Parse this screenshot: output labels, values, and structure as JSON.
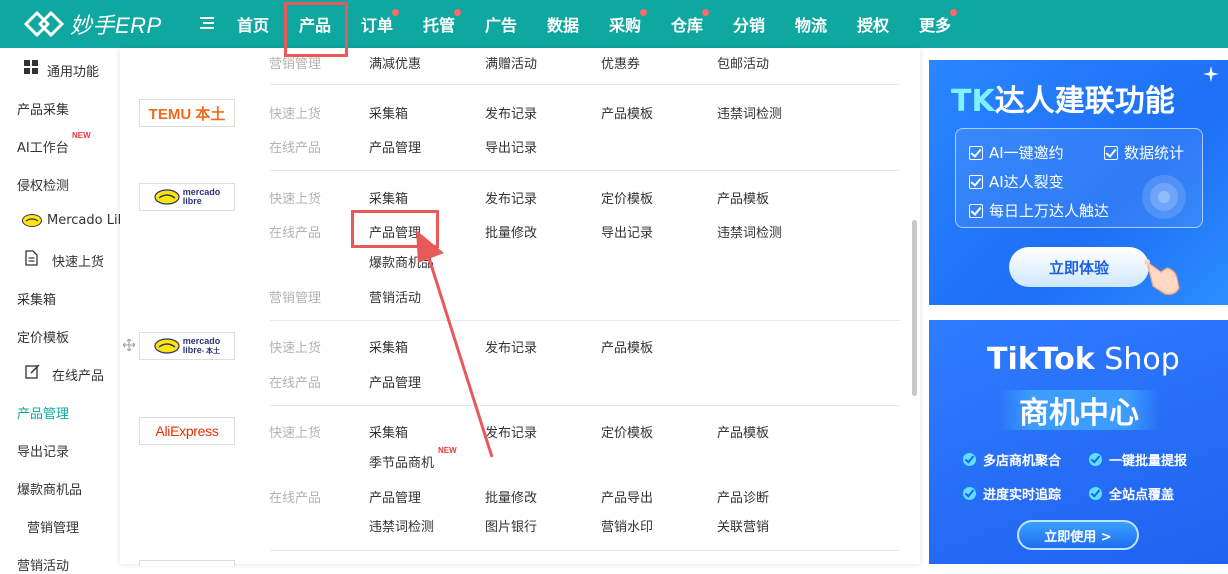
{
  "app": {
    "logo_text": "妙手ERP"
  },
  "nav": [
    {
      "label": "首页",
      "dot": false
    },
    {
      "label": "产品",
      "dot": false
    },
    {
      "label": "订单",
      "dot": true
    },
    {
      "label": "托管",
      "dot": true
    },
    {
      "label": "广告",
      "dot": false
    },
    {
      "label": "数据",
      "dot": false
    },
    {
      "label": "采购",
      "dot": true
    },
    {
      "label": "仓库",
      "dot": true
    },
    {
      "label": "分销",
      "dot": false
    },
    {
      "label": "物流",
      "dot": false
    },
    {
      "label": "授权",
      "dot": false
    },
    {
      "label": "更多",
      "dot": true
    }
  ],
  "sidebar": {
    "items": [
      {
        "label": "通用功能"
      },
      {
        "label": "产品采集"
      },
      {
        "label": "AI工作台",
        "badge": "NEW"
      },
      {
        "label": "侵权检测"
      },
      {
        "label": "Mercado Lib"
      },
      {
        "label": "快速上货"
      },
      {
        "label": "采集箱"
      },
      {
        "label": "定价模板"
      },
      {
        "label": "在线产品"
      },
      {
        "label": "产品管理"
      },
      {
        "label": "导出记录"
      },
      {
        "label": "爆款商机品"
      },
      {
        "label": "营销管理"
      },
      {
        "label": "营销活动"
      }
    ]
  },
  "panel": {
    "top_row": {
      "category": "营销管理",
      "links": [
        "满减优惠",
        "满赠活动",
        "优惠券",
        "包邮活动"
      ]
    },
    "temu": {
      "brand": "TEMU 本土",
      "rows": [
        {
          "category": "快速上货",
          "links": [
            "采集箱",
            "发布记录",
            "产品模板",
            "违禁词检测"
          ]
        },
        {
          "category": "在线产品",
          "links": [
            "产品管理",
            "导出记录"
          ]
        }
      ]
    },
    "mercado": {
      "brand_line1": "mercado",
      "brand_line2": "libre",
      "rows": [
        {
          "category": "快速上货",
          "links": [
            "采集箱",
            "发布记录",
            "定价模板",
            "产品模板"
          ]
        },
        {
          "category": "在线产品",
          "links": [
            "产品管理",
            "批量修改",
            "导出记录",
            "违禁词检测",
            "爆款商机品"
          ]
        },
        {
          "category": "营销管理",
          "links": [
            "营销活动"
          ]
        }
      ]
    },
    "mercado_local": {
      "brand_line1": "mercado",
      "brand_line2": "libre",
      "brand_suffix": "- 本土",
      "rows": [
        {
          "category": "快速上货",
          "links": [
            "采集箱",
            "发布记录",
            "产品模板"
          ]
        },
        {
          "category": "在线产品",
          "links": [
            "产品管理"
          ]
        }
      ]
    },
    "aliexpress": {
      "brand": "AliExpress",
      "rows": [
        {
          "category": "快速上货",
          "links": [
            "采集箱",
            "发布记录",
            "定价模板",
            "产品模板",
            "季节品商机"
          ],
          "badge": "NEW"
        },
        {
          "category": "在线产品",
          "links": [
            "产品管理",
            "批量修改",
            "产品导出",
            "产品诊断",
            "违禁词检测",
            "图片银行",
            "营销水印",
            "关联营销"
          ]
        }
      ]
    }
  },
  "banner1": {
    "title_tk": "TK",
    "title_rest": "达人建联功能",
    "features": [
      "AI一键邀约",
      "数据统计",
      "AI达人裂变",
      "每日上万达人触达"
    ],
    "button": "立即体验"
  },
  "banner2": {
    "title_bold": "TikTok",
    "title_thin": " Shop",
    "subtitle": "商机中心",
    "features": [
      "多店商机聚合",
      "一键批量提报",
      "进度实时追踪",
      "全站点覆盖"
    ],
    "button": "立即使用 >"
  },
  "colors": {
    "brand": "#0fa8a0",
    "highlight": "#e85a5a",
    "muted": "#b3b3b3"
  }
}
